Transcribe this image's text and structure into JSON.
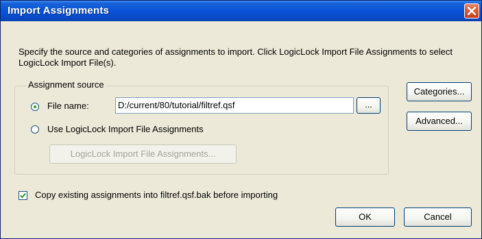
{
  "window": {
    "title": "Import Assignments"
  },
  "description": "Specify the source and categories of assignments to import. Click LogicLock Import File Assignments to select LogicLock Import File(s).",
  "assignment_source": {
    "group_label": "Assignment source",
    "file_name_label": "File name:",
    "file_name_value": "D:/current/80/tutorial/filtref.qsf",
    "browse_label": "...",
    "use_logiclock_label": "Use LogicLock Import File Assignments",
    "logiclock_button_label": "LogicLock Import File Assignments...",
    "selected": "file_name"
  },
  "side_buttons": {
    "categories": "Categories...",
    "advanced": "Advanced..."
  },
  "copy_checkbox": {
    "label": "Copy existing assignments into filtref.qsf.bak before importing",
    "checked": true
  },
  "footer": {
    "ok": "OK",
    "cancel": "Cancel"
  },
  "colors": {
    "titlebar": "#0a54d8",
    "dialog_bg": "#ece9d8",
    "close_button": "#d95b3a",
    "radio_dot": "#21a121"
  }
}
